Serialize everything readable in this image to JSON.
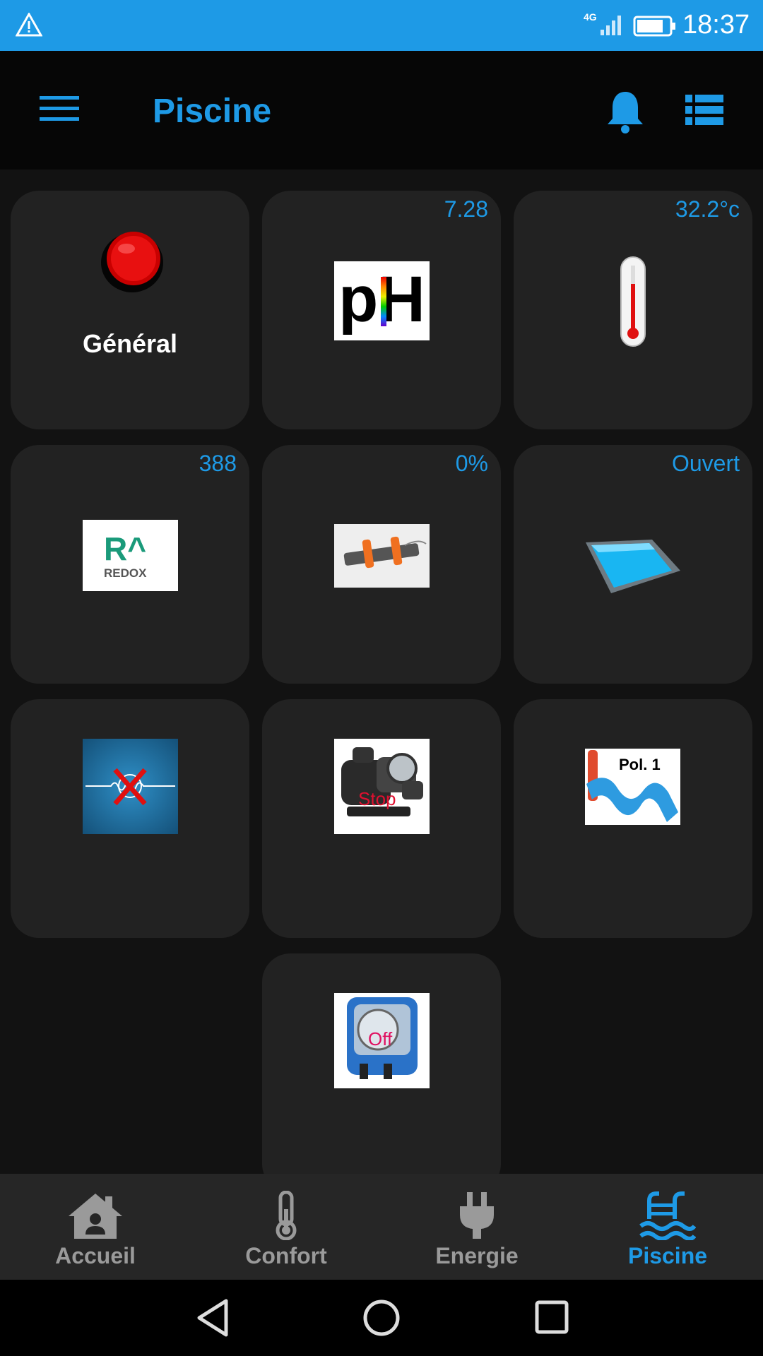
{
  "status_bar": {
    "network": "4G",
    "time": "18:37",
    "icons": [
      "warning-icon",
      "signal-icon",
      "battery-icon"
    ]
  },
  "app_bar": {
    "title": "Piscine",
    "icons": [
      "menu-icon",
      "bell-icon",
      "list-icon"
    ]
  },
  "tiles": [
    {
      "id": "general",
      "label": "Général",
      "value": "",
      "icon": "red-button-icon"
    },
    {
      "id": "ph",
      "label": "",
      "value": "7.28",
      "icon": "ph-icon",
      "image_text": "pH"
    },
    {
      "id": "temperature",
      "label": "",
      "value": "32.2°c",
      "icon": "thermometer-icon"
    },
    {
      "id": "redox",
      "label": "",
      "value": "388",
      "icon": "redox-icon",
      "image_text": "REDOX"
    },
    {
      "id": "electrolyser",
      "label": "",
      "value": "0%",
      "icon": "electrolyser-icon"
    },
    {
      "id": "cover",
      "label": "",
      "value": "Ouvert",
      "icon": "pool-icon"
    },
    {
      "id": "antifreeze",
      "label": "",
      "value": "",
      "icon": "antifreeze-disabled-icon"
    },
    {
      "id": "pump",
      "label": "",
      "value": "",
      "icon": "pump-icon",
      "image_text": "Stop"
    },
    {
      "id": "polarity",
      "label": "",
      "value": "",
      "icon": "polarity-icon",
      "image_text": "Pol. 1"
    },
    {
      "id": "dosing_pump",
      "label": "",
      "value": "",
      "icon": "dosing-pump-icon",
      "image_text": "Off"
    }
  ],
  "bottom_nav": {
    "items": [
      {
        "label": "Accueil",
        "icon": "home-icon",
        "active": false
      },
      {
        "label": "Confort",
        "icon": "thermometer-icon",
        "active": false
      },
      {
        "label": "Energie",
        "icon": "plug-icon",
        "active": false
      },
      {
        "label": "Piscine",
        "icon": "pool-icon",
        "active": true
      }
    ]
  },
  "system_nav": [
    "back-icon",
    "home-circle-icon",
    "recents-icon"
  ],
  "colors": {
    "accent": "#1e9ae6",
    "background": "#121212",
    "tile": "#222222",
    "inactive": "#9a9a9a"
  }
}
